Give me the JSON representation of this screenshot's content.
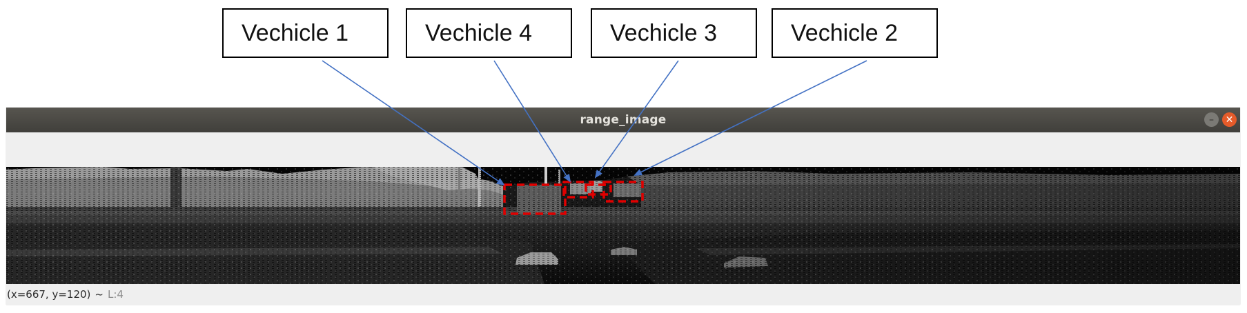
{
  "callouts": [
    {
      "label": "Vechicle 1"
    },
    {
      "label": "Vechicle 4"
    },
    {
      "label": "Vechicle 3"
    },
    {
      "label": "Vechicle 2"
    }
  ],
  "window": {
    "title": "range_image",
    "minimize_glyph": "–",
    "close_glyph": "✕"
  },
  "status": {
    "coords": "(x=667, y=120)",
    "separator": "~",
    "level": "L:4"
  },
  "colors": {
    "arrow": "#4472c4",
    "box": "#e00000",
    "titlebar": "#4a4944",
    "close_button": "#e55b2a"
  }
}
